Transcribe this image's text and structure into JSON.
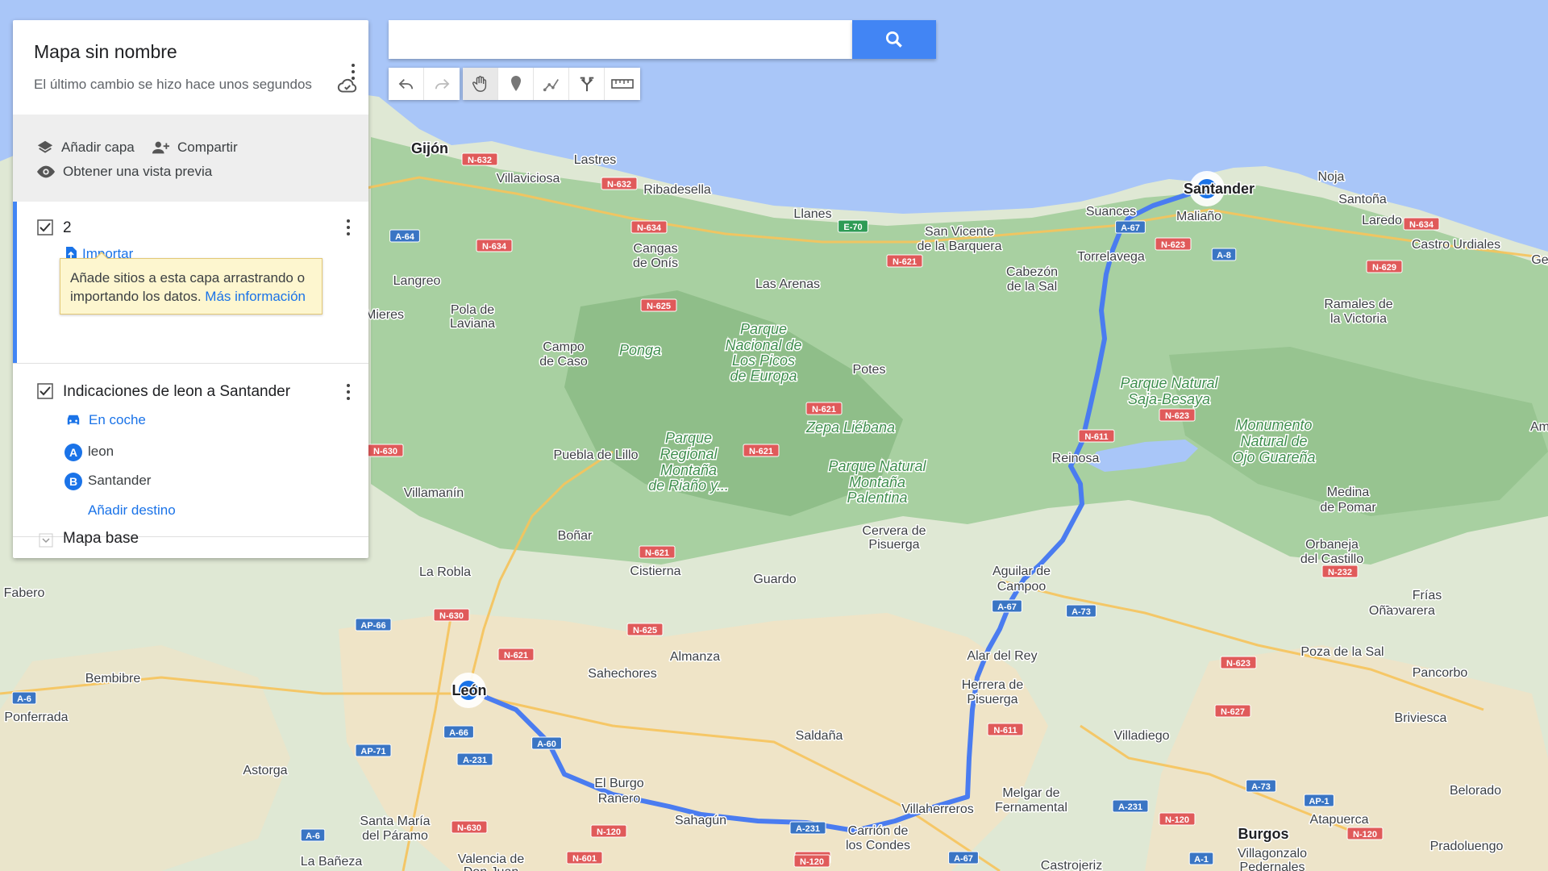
{
  "panel": {
    "title": "Mapa sin nombre",
    "subtitle": "El último cambio se hizo hace unos segundos",
    "actions": {
      "add_layer": "Añadir capa",
      "share": "Compartir",
      "preview": "Obtener una vista previa"
    },
    "layer1": {
      "name": "2",
      "import_label": "Importar",
      "tip_text": "Añade sitios a esta capa arrastrando o importando los datos.",
      "tip_link": "Más información"
    },
    "layer2": {
      "name": "Indicaciones de leon a Santander",
      "mode": "En coche",
      "waypoints": [
        {
          "letter": "A",
          "label": "leon"
        },
        {
          "letter": "B",
          "label": "Santander"
        }
      ],
      "add_destination": "Añadir destino"
    },
    "base_map": "Mapa base"
  },
  "search": {
    "value": "",
    "placeholder": ""
  },
  "toolbar": {
    "icons": [
      "undo-icon",
      "redo-icon",
      "hand-icon",
      "marker-icon",
      "draw-line-icon",
      "directions-icon",
      "ruler-icon"
    ]
  },
  "colors": {
    "water": "#a9c6f8",
    "land": "#dfe8d4",
    "forest": "#9fcb98",
    "route": "#4a7cf0",
    "accent": "#4285f4"
  },
  "map": {
    "places": [
      {
        "name": "Gijón",
        "cls": "mlb"
      },
      {
        "name": "Lastres",
        "cls": "ml"
      },
      {
        "name": "Villaviciosa",
        "cls": "ml"
      },
      {
        "name": "Ribadesella",
        "cls": "ml"
      },
      {
        "name": "Llanes",
        "cls": "ml"
      },
      {
        "name": "San Vicente",
        "cls": "ml"
      },
      {
        "name": "de la Barquera",
        "cls": "ml"
      },
      {
        "name": "Suances",
        "cls": "ml"
      },
      {
        "name": "Santander",
        "cls": "mlb"
      },
      {
        "name": "Maliaño",
        "cls": "ml"
      },
      {
        "name": "Noja",
        "cls": "ml"
      },
      {
        "name": "Santoña",
        "cls": "ml"
      },
      {
        "name": "Laredo",
        "cls": "ml"
      },
      {
        "name": "Castro Urdiales",
        "cls": "ml"
      },
      {
        "name": "Torrelavega",
        "cls": "ml"
      },
      {
        "name": "Cabezón",
        "cls": "ml"
      },
      {
        "name": "de la Sal",
        "cls": "ml"
      },
      {
        "name": "Cangas",
        "cls": "ml"
      },
      {
        "name": "de Onís",
        "cls": "ml"
      },
      {
        "name": "Langreo",
        "cls": "ml"
      },
      {
        "name": "Pola de",
        "cls": "ml"
      },
      {
        "name": "Laviana",
        "cls": "ml"
      },
      {
        "name": "Mieres",
        "cls": "ml"
      },
      {
        "name": "Las Arenas",
        "cls": "ml"
      },
      {
        "name": "Ramales de",
        "cls": "ml"
      },
      {
        "name": "la Victoria",
        "cls": "ml"
      },
      {
        "name": "Campo",
        "cls": "ml"
      },
      {
        "name": "de Caso",
        "cls": "ml"
      },
      {
        "name": "Ponga",
        "cls": "mlg"
      },
      {
        "name": "Parque",
        "cls": "mlg"
      },
      {
        "name": "Nacional de",
        "cls": "mlg"
      },
      {
        "name": "Los Picos",
        "cls": "mlg"
      },
      {
        "name": "de Europa",
        "cls": "mlg"
      },
      {
        "name": "Potes",
        "cls": "ml"
      },
      {
        "name": "Parque Natural",
        "cls": "mlg"
      },
      {
        "name": "Saja-Besaya",
        "cls": "mlg"
      },
      {
        "name": "Zepa Liébana",
        "cls": "mlg"
      },
      {
        "name": "Parque",
        "cls": "mlg"
      },
      {
        "name": "Regional",
        "cls": "mlg"
      },
      {
        "name": "Montaña",
        "cls": "mlg"
      },
      {
        "name": "de Riaño y...",
        "cls": "mlg"
      },
      {
        "name": "Parque Natural",
        "cls": "mlg"
      },
      {
        "name": "Montaña",
        "cls": "mlg"
      },
      {
        "name": "Palentina",
        "cls": "mlg"
      },
      {
        "name": "Puebla de Lillo",
        "cls": "ml"
      },
      {
        "name": "Reinosa",
        "cls": "ml"
      },
      {
        "name": "Monumento",
        "cls": "mlg"
      },
      {
        "name": "Natural de",
        "cls": "mlg"
      },
      {
        "name": "Ojo Guareña",
        "cls": "mlg"
      },
      {
        "name": "Villamanín",
        "cls": "ml"
      },
      {
        "name": "Medina",
        "cls": "ml"
      },
      {
        "name": "de Pomar",
        "cls": "ml"
      },
      {
        "name": "Boñar",
        "cls": "ml"
      },
      {
        "name": "Cervera de",
        "cls": "ml"
      },
      {
        "name": "Pisuerga",
        "cls": "ml"
      },
      {
        "name": "Orbaneja",
        "cls": "ml"
      },
      {
        "name": "del Castillo",
        "cls": "ml"
      },
      {
        "name": "La Robla",
        "cls": "ml"
      },
      {
        "name": "Cistierna",
        "cls": "ml"
      },
      {
        "name": "Guardo",
        "cls": "ml"
      },
      {
        "name": "Aguilar de",
        "cls": "ml"
      },
      {
        "name": "Campoo",
        "cls": "ml"
      },
      {
        "name": "Frías",
        "cls": "ml"
      },
      {
        "name": "Fabero",
        "cls": "ml"
      },
      {
        "name": "Covarera",
        "cls": "ml"
      },
      {
        "name": "Oña",
        "cls": "ml"
      },
      {
        "name": "Almanza",
        "cls": "ml"
      },
      {
        "name": "Alar del Rey",
        "cls": "ml"
      },
      {
        "name": "Poza de la Sal",
        "cls": "ml"
      },
      {
        "name": "Bembibre",
        "cls": "ml"
      },
      {
        "name": "Pancorbo",
        "cls": "ml"
      },
      {
        "name": "Sahechores",
        "cls": "ml"
      },
      {
        "name": "León",
        "cls": "mlb"
      },
      {
        "name": "Herrera de",
        "cls": "ml"
      },
      {
        "name": "Pisuerga",
        "cls": "ml"
      },
      {
        "name": "Ponferrada",
        "cls": "ml"
      },
      {
        "name": "Briviesca",
        "cls": "ml"
      },
      {
        "name": "Saldaña",
        "cls": "ml"
      },
      {
        "name": "Villadiego",
        "cls": "ml"
      },
      {
        "name": "Astorga",
        "cls": "ml"
      },
      {
        "name": "El Burgo",
        "cls": "ml"
      },
      {
        "name": "Ranero",
        "cls": "ml"
      },
      {
        "name": "Belorado",
        "cls": "ml"
      },
      {
        "name": "Melgar de",
        "cls": "ml"
      },
      {
        "name": "Fernamental",
        "cls": "ml"
      },
      {
        "name": "Villaherreros",
        "cls": "ml"
      },
      {
        "name": "Sahagún",
        "cls": "ml"
      },
      {
        "name": "Santa María",
        "cls": "ml"
      },
      {
        "name": "del Páramo",
        "cls": "ml"
      },
      {
        "name": "Atapuerca",
        "cls": "ml"
      },
      {
        "name": "Carrión de",
        "cls": "ml"
      },
      {
        "name": "los Condes",
        "cls": "ml"
      },
      {
        "name": "Burgos",
        "cls": "mlb"
      },
      {
        "name": "Valencia de",
        "cls": "ml"
      },
      {
        "name": "Don Juan",
        "cls": "ml"
      },
      {
        "name": "La Bañeza",
        "cls": "ml"
      },
      {
        "name": "Castrojeriz",
        "cls": "ml"
      },
      {
        "name": "Villagonzalo",
        "cls": "ml"
      },
      {
        "name": "Pedernales",
        "cls": "ml"
      },
      {
        "name": "Pradoluengo",
        "cls": "ml"
      },
      {
        "name": "Ge",
        "cls": "ml"
      },
      {
        "name": "Am",
        "cls": "ml"
      }
    ],
    "roads": [
      {
        "label": "N-632",
        "type": "n"
      },
      {
        "label": "N-632",
        "type": "n"
      },
      {
        "label": "N-634",
        "type": "n"
      },
      {
        "label": "E-70",
        "type": "e"
      },
      {
        "label": "N-621",
        "type": "n"
      },
      {
        "label": "A-67",
        "type": "a"
      },
      {
        "label": "N-623",
        "type": "n"
      },
      {
        "label": "A-8",
        "type": "a"
      },
      {
        "label": "N-634",
        "type": "n"
      },
      {
        "label": "N-629",
        "type": "n"
      },
      {
        "label": "A-64",
        "type": "a"
      },
      {
        "label": "N-634",
        "type": "n"
      },
      {
        "label": "N-625",
        "type": "n"
      },
      {
        "label": "N-621",
        "type": "n"
      },
      {
        "label": "N-611",
        "type": "n"
      },
      {
        "label": "N-623",
        "type": "n"
      },
      {
        "label": "N-621",
        "type": "n"
      },
      {
        "label": "N-630",
        "type": "n"
      },
      {
        "label": "N-621",
        "type": "n"
      },
      {
        "label": "N-232",
        "type": "n"
      },
      {
        "label": "A-67",
        "type": "a"
      },
      {
        "label": "A-73",
        "type": "a"
      },
      {
        "label": "AP-66",
        "type": "a"
      },
      {
        "label": "N-630",
        "type": "n"
      },
      {
        "label": "N-625",
        "type": "n"
      },
      {
        "label": "N-621",
        "type": "n"
      },
      {
        "label": "N-623",
        "type": "n"
      },
      {
        "label": "A-6",
        "type": "a"
      },
      {
        "label": "A-66",
        "type": "a"
      },
      {
        "label": "A-60",
        "type": "a"
      },
      {
        "label": "N-611",
        "type": "n"
      },
      {
        "label": "N-627",
        "type": "n"
      },
      {
        "label": "AP-71",
        "type": "a"
      },
      {
        "label": "A-231",
        "type": "a"
      },
      {
        "label": "A-73",
        "type": "a"
      },
      {
        "label": "AP-1",
        "type": "a"
      },
      {
        "label": "A-6",
        "type": "a"
      },
      {
        "label": "N-630",
        "type": "n"
      },
      {
        "label": "N-120",
        "type": "n"
      },
      {
        "label": "A-231",
        "type": "a"
      },
      {
        "label": "A-231",
        "type": "a"
      },
      {
        "label": "N-120",
        "type": "n"
      },
      {
        "label": "N-120",
        "type": "n"
      },
      {
        "label": "N-601",
        "type": "n"
      },
      {
        "label": "N-120",
        "type": "n"
      },
      {
        "label": "A-67",
        "type": "a"
      },
      {
        "label": "N-120",
        "type": "n"
      },
      {
        "label": "A-1",
        "type": "a"
      }
    ],
    "marker_a": "A",
    "marker_b": "B"
  }
}
